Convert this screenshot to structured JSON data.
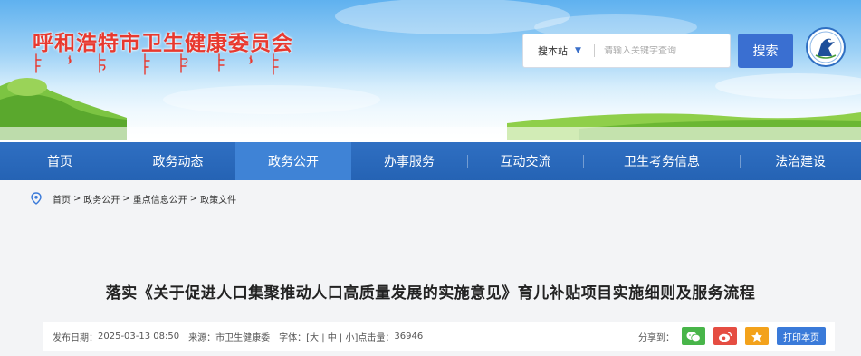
{
  "site": {
    "title": "呼和浩特市卫生健康委员会"
  },
  "search": {
    "scope_label": "搜本站",
    "placeholder": "请输入关键字查询",
    "button_label": "搜索"
  },
  "nav": {
    "items": [
      {
        "label": "首页",
        "active": false
      },
      {
        "label": "政务动态",
        "active": false
      },
      {
        "label": "政务公开",
        "active": true
      },
      {
        "label": "办事服务",
        "active": false
      },
      {
        "label": "互动交流",
        "active": false
      },
      {
        "label": "卫生考务信息",
        "active": false
      },
      {
        "label": "法治建设",
        "active": false
      }
    ]
  },
  "breadcrumb": {
    "items": [
      "首页",
      "政务公开",
      "重点信息公开",
      "政策文件"
    ],
    "separator": ">"
  },
  "article": {
    "title": "落实《关于促进人口集聚推动人口高质量发展的实施意见》育儿补贴项目实施细则及服务流程",
    "publish_label": "发布日期：",
    "publish_date": "2025-03-13 08:50",
    "source_label": "来源：",
    "source": "市卫生健康委",
    "font_label": "字体：",
    "font_options": "[大 | 中 | 小]",
    "hits_label": "点击量：",
    "hits": "36946"
  },
  "share": {
    "label": "分享到：",
    "print_label": "打印本页"
  },
  "colors": {
    "title_red": "#e8392f",
    "nav_blue": "#2563b4",
    "nav_active": "#3f83d6",
    "search_blue": "#3a6fd1"
  }
}
